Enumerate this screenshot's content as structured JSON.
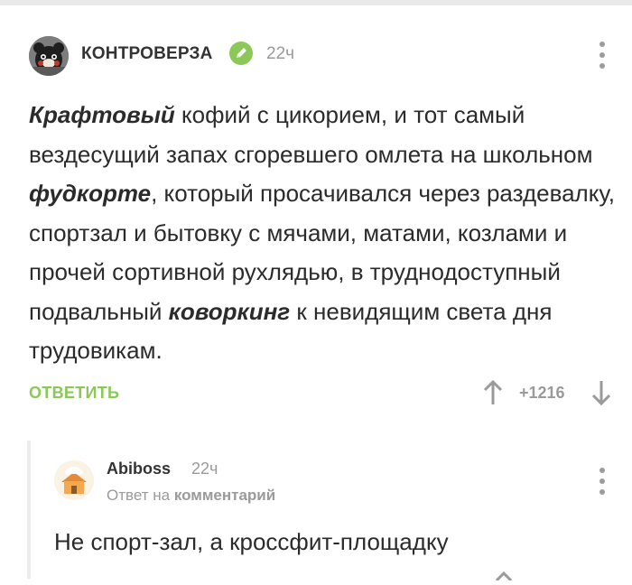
{
  "comment": {
    "author": "КОНТРОВЕРЗА",
    "time": "22ч",
    "text_parts": [
      {
        "t": "Крафтовый",
        "b": true
      },
      {
        "t": " кофий с цикорием, и тот самый вездесущий запах сгоревшего омлета на школьном ",
        "b": false
      },
      {
        "t": "фудкорте",
        "b": true
      },
      {
        "t": ", который просачивался через раздевалку, спортзал и бытовку с мячами, матами, козлами и прочей сортивной рухлядью, в труднодоступный подвальный ",
        "b": false
      },
      {
        "t": "коворкинг",
        "b": true
      },
      {
        "t": " к невидящим света дня трудовикам.",
        "b": false
      }
    ],
    "reply_label": "ОТВЕТИТЬ",
    "rating": "+1216",
    "icons": {
      "avatar": "bear-mascot-avatar",
      "verified": "pencil-verified-icon",
      "more": "more-vertical-icon",
      "up": "arrow-up-icon",
      "down": "arrow-down-icon"
    },
    "colors": {
      "accent": "#8ac858",
      "muted": "#9a9a9a"
    }
  },
  "reply": {
    "author": "Abiboss",
    "time": "22ч",
    "reply_to_prefix": "Ответ на",
    "reply_to_target": "комментарий",
    "text": "Не спорт-зал, а кроссфит-площадку",
    "icons": {
      "avatar": "house-avatar",
      "more": "more-vertical-icon"
    }
  }
}
